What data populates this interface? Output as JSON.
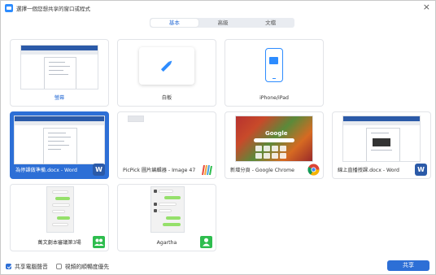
{
  "window": {
    "title": "選擇一個您想共享的窗口或程式",
    "close_glyph": "×"
  },
  "tabs": [
    {
      "label": "基本",
      "active": true
    },
    {
      "label": "高級",
      "active": false
    },
    {
      "label": "文檔",
      "active": false
    }
  ],
  "tiles": [
    {
      "label": "螢幕",
      "icon": "screen-icon"
    },
    {
      "label": "白板",
      "icon": "pencil-icon"
    },
    {
      "label": "iPhone/iPad",
      "icon": "airplay-icon"
    },
    {
      "label": "為停課做準備.docx - Word",
      "app": "Word",
      "badge": "W",
      "selected": true
    },
    {
      "label": "PicPick 圖片編輯器 - Image 47",
      "app": "PicPick"
    },
    {
      "label": "新增分頁 - Google Chrome",
      "app": "Google Chrome",
      "preview_text": "Google"
    },
    {
      "label": "線上直播授課.docx - Word",
      "app": "Word",
      "badge": "W"
    },
    {
      "label": "萬文劇本審議第3場",
      "app": "WeChat group",
      "icon": "group-chat-icon"
    },
    {
      "label": "Agartha",
      "app": "WeChat contact",
      "icon": "contact-icon"
    }
  ],
  "bottom": {
    "share_audio_label": "共享電腦聲音",
    "share_audio_checked": true,
    "optimize_video_label": "視頻的順暢度優先",
    "optimize_video_checked": false,
    "share_button_label": "共享"
  },
  "colors": {
    "accent": "#2d6fd6",
    "word_blue": "#2b5aa8",
    "wechat_green": "#2ebd4e"
  }
}
